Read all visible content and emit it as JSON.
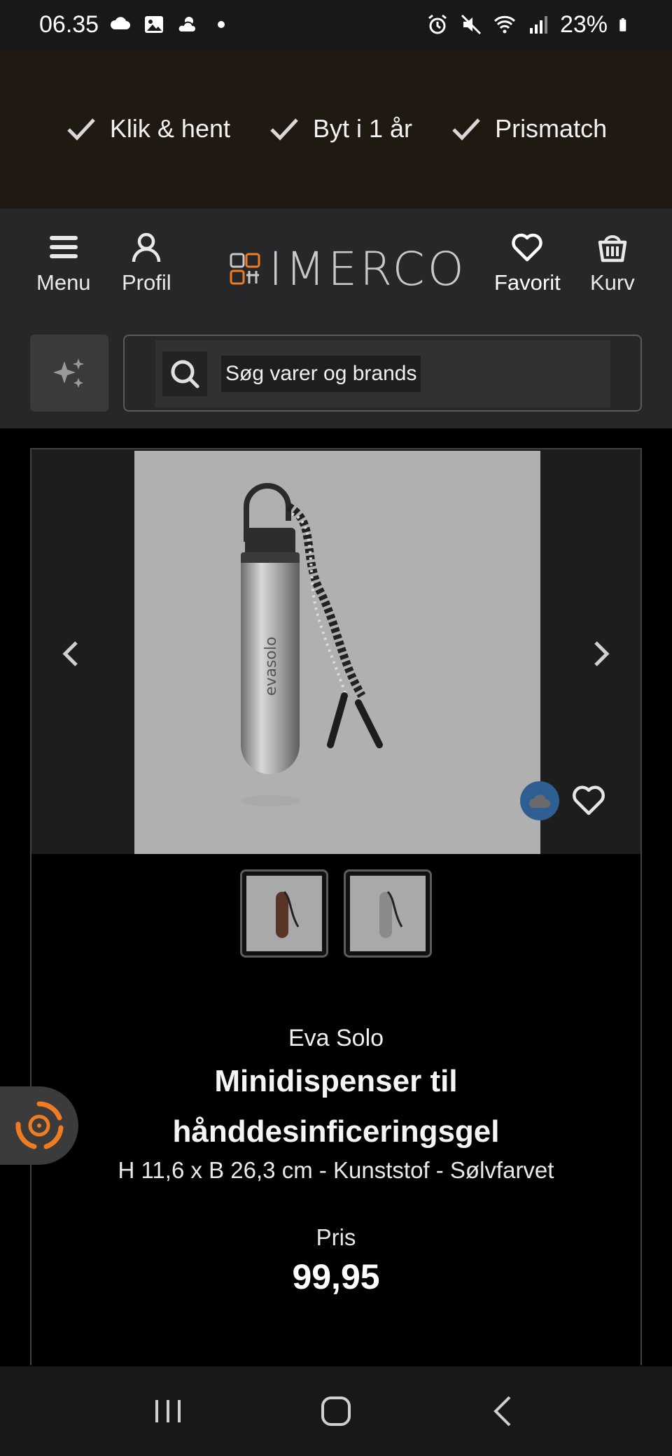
{
  "status_bar": {
    "time": "06.35",
    "battery": "23%",
    "left_icons": [
      "cloud-icon",
      "image-icon",
      "weather-icon",
      "dot-icon"
    ],
    "right_icons": [
      "alarm-icon",
      "mute-icon",
      "wifi-icon",
      "signal-icon",
      "battery-icon"
    ]
  },
  "promo": {
    "items": [
      {
        "label": "Klik & hent",
        "icon": "check-icon"
      },
      {
        "label": "Byt i 1 år",
        "icon": "check-icon"
      },
      {
        "label": "Prismatch",
        "icon": "check-icon"
      }
    ]
  },
  "header": {
    "menu_label": "Menu",
    "profile_label": "Profil",
    "logo_text": "IMERCO",
    "favorite_label": "Favorit",
    "cart_label": "Kurv"
  },
  "search": {
    "placeholder": "Søg varer og brands"
  },
  "product": {
    "brand": "Eva Solo",
    "title_line1": "Minidispenser til",
    "title_line2": "hånddesinficeringsgel",
    "subtitle": "H 11,6 x B 26,3 cm - Kunststof - Sølvfarvet",
    "price_label": "Pris",
    "price": "99,95",
    "image_engraving": "evasolo"
  },
  "colors": {
    "promo_bg": "#1f1912",
    "header_bg": "#262728",
    "accent_orange": "#f07c22",
    "fav_badge": "#2f5e93"
  }
}
